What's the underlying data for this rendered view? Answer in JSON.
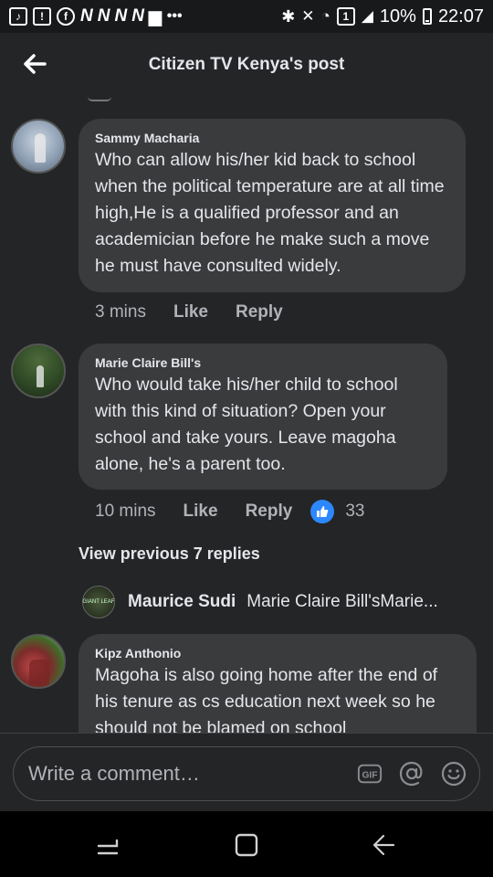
{
  "status_bar": {
    "notification_letters": [
      "N",
      "N",
      "N",
      "N"
    ],
    "sim_badge": "1",
    "more": "•••",
    "battery": "10%",
    "time": "22:07"
  },
  "header": {
    "title": "Citizen TV Kenya's post"
  },
  "comments": [
    {
      "name": "Sammy Macharia",
      "text": "Who can allow his/her kid back to school when the political temperature are at all time high,He is  a qualified professor and an academician before he make such a move he must have consulted widely.",
      "time": "3 mins",
      "like": "Like",
      "reply": "Reply"
    },
    {
      "name": "Marie Claire Bill's",
      "text": "Who would take his/her child to school with this kind of situation? Open your school and take yours. Leave magoha alone, he's a parent too.",
      "time": "10 mins",
      "like": "Like",
      "reply": "Reply",
      "reaction_count": "33"
    },
    {
      "name": "Kipz Anthonio",
      "text": "Magoha is also going home after the end of his tenure as cs education next week so he should not be blamed on school"
    }
  ],
  "view_previous": "View previous 7 replies",
  "reply_preview": {
    "avatar_text": "GIANT LEAF",
    "name": "Maurice Sudi",
    "text": "Marie Claire Bill'sMarie..."
  },
  "composer": {
    "placeholder": "Write a comment…",
    "gif_label": "GIF"
  },
  "colors": {
    "background": "#242526",
    "bubble": "#3a3b3c",
    "accent_like": "#2d88ff",
    "secondary_text": "#b0b3b8"
  }
}
